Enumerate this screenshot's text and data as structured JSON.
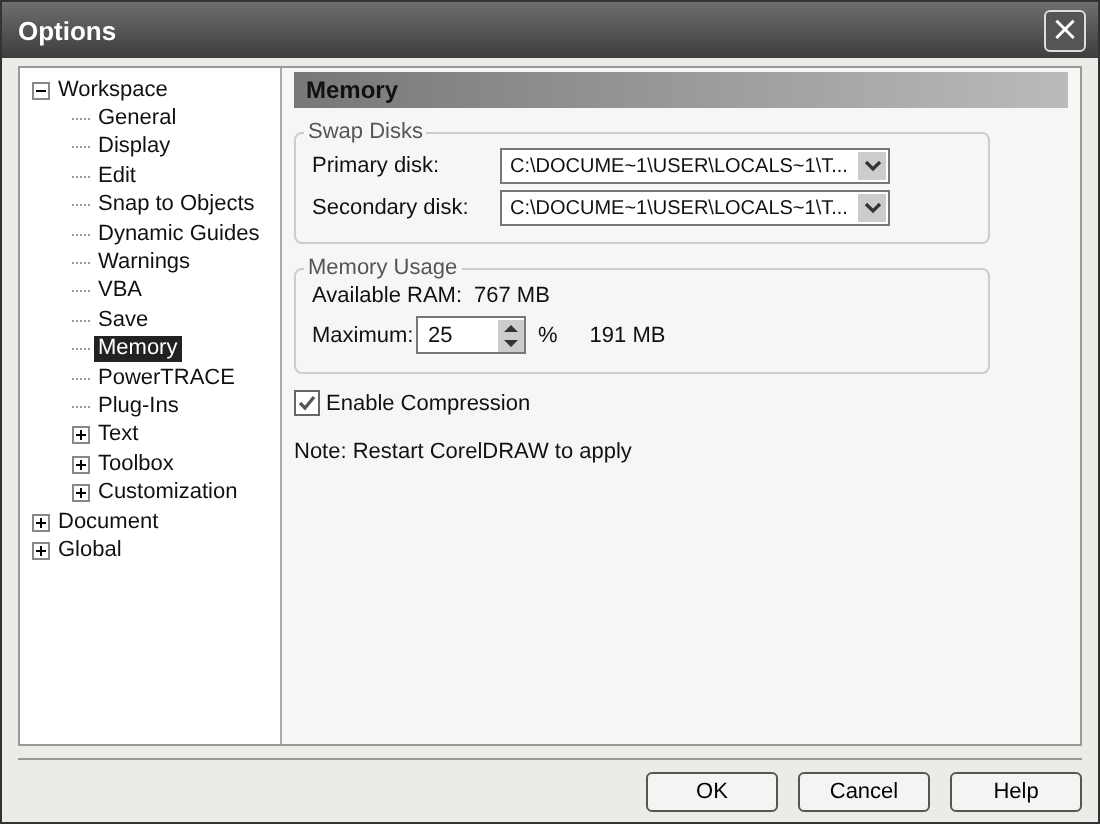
{
  "window": {
    "title": "Options",
    "close": "×"
  },
  "tree": [
    {
      "label": "Workspace",
      "expanded": true,
      "selected": false,
      "children": [
        {
          "label": "General",
          "selected": false
        },
        {
          "label": "Display",
          "selected": false
        },
        {
          "label": "Edit",
          "selected": false
        },
        {
          "label": "Snap to Objects",
          "selected": false
        },
        {
          "label": "Dynamic Guides",
          "selected": false
        },
        {
          "label": "Warnings",
          "selected": false
        },
        {
          "label": "VBA",
          "selected": false
        },
        {
          "label": "Save",
          "selected": false
        },
        {
          "label": "Memory",
          "selected": true
        },
        {
          "label": "PowerTRACE",
          "selected": false
        },
        {
          "label": "Plug-Ins",
          "selected": false
        },
        {
          "label": "Text",
          "selected": false,
          "expanded": false
        },
        {
          "label": "Toolbox",
          "selected": false,
          "expanded": false
        },
        {
          "label": "Customization",
          "selected": false,
          "expanded": false
        }
      ]
    },
    {
      "label": "Document",
      "expanded": false,
      "selected": false
    },
    {
      "label": "Global",
      "expanded": false,
      "selected": false
    }
  ],
  "panel": {
    "title": "Memory",
    "swap_disks": {
      "legend": "Swap Disks",
      "rows": [
        {
          "label": "Primary disk:",
          "value": "C:\\DOCUME~1\\USER\\LOCALS~1\\T..."
        },
        {
          "label": "Secondary disk:",
          "value": "C:\\DOCUME~1\\USER\\LOCALS~1\\T..."
        }
      ]
    },
    "memory_usage": {
      "legend": "Memory Usage",
      "available_label": "Available RAM:",
      "available_value": "767 MB",
      "maximum_label": "Maximum:",
      "maximum_value": "25",
      "unit": "%",
      "maximum_size": "191 MB"
    },
    "compression": {
      "label": "Enable Compression",
      "checked": true
    },
    "note": "Note: Restart CorelDRAW to apply"
  },
  "buttons": [
    "OK",
    "Cancel",
    "Help"
  ]
}
